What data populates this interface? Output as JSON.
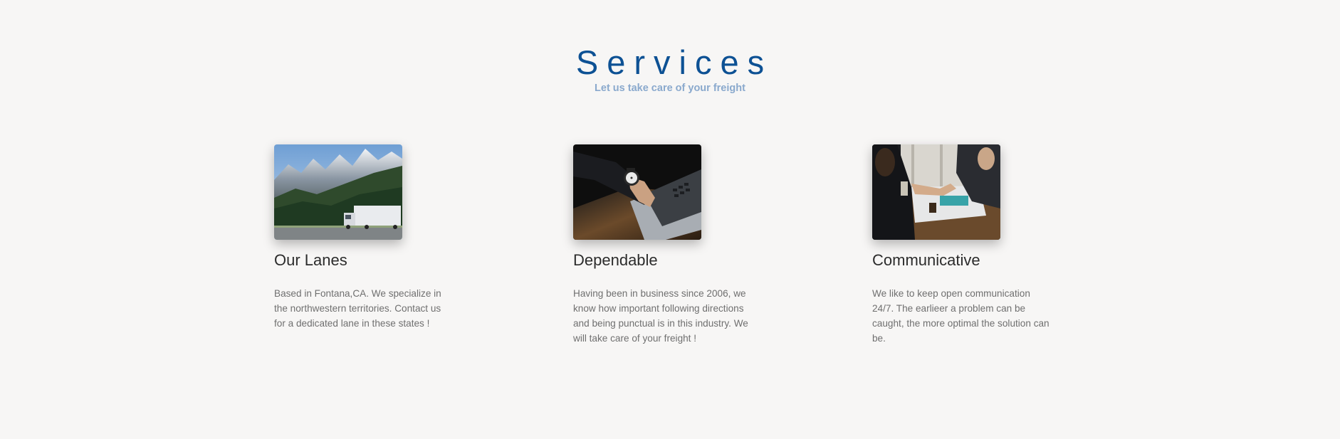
{
  "section": {
    "title": "Services",
    "subtitle": "Let us take care of your freight"
  },
  "cards": [
    {
      "title": "Our Lanes",
      "text": "Based in Fontana,CA. We specialize in the northwestern territories. Contact us for a dedicated lane in these states !",
      "image_icon": "mountain-truck-photo"
    },
    {
      "title": "Dependable",
      "text": "Having been in business since 2006, we know how important following directions and being punctual is in this industry. We will take care of your freight !",
      "image_icon": "wristwatch-laptop-photo"
    },
    {
      "title": "Communicative",
      "text": "We like to keep open communication 24/7. The earlieer a problem can be caught, the more optimal the solution can be.",
      "image_icon": "handshake-meeting-photo"
    }
  ],
  "colors": {
    "background": "#f7f6f5",
    "title": "#0d5194",
    "subtitle": "#8aa9cd",
    "card_title": "#2c2c2c",
    "card_text": "#6f6f6f"
  }
}
